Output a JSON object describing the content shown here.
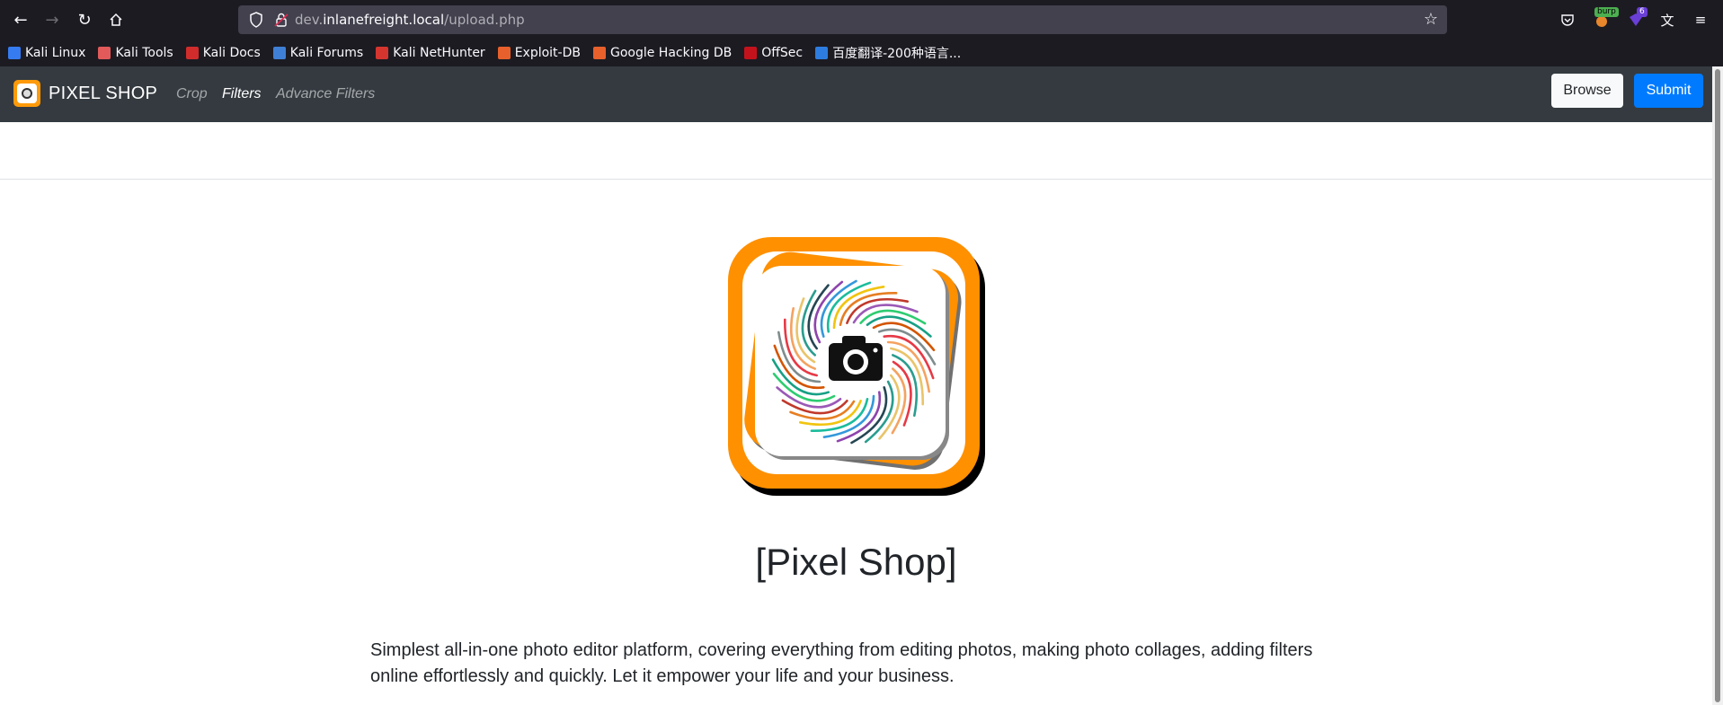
{
  "browser": {
    "url_prefix": "dev.",
    "url_host": "inlanefreight.local",
    "url_path": "/upload.php",
    "extensions": {
      "burp_badge": "burp",
      "notif_badge": "6"
    }
  },
  "bookmarks": [
    {
      "label": "Kali Linux",
      "color": "#367bf0"
    },
    {
      "label": "Kali Tools",
      "color": "#e25a5a"
    },
    {
      "label": "Kali Docs",
      "color": "#d12c2c"
    },
    {
      "label": "Kali Forums",
      "color": "#3f7fd6"
    },
    {
      "label": "Kali NetHunter",
      "color": "#d6352f"
    },
    {
      "label": "Exploit-DB",
      "color": "#e8602c"
    },
    {
      "label": "Google Hacking DB",
      "color": "#e8602c"
    },
    {
      "label": "OffSec",
      "color": "#c4121d"
    },
    {
      "label": "百度翻译-200种语言...",
      "color": "#2d7de0"
    }
  ],
  "navbar": {
    "brand": "PIXEL SHOP",
    "links": [
      {
        "label": "Crop",
        "active": false
      },
      {
        "label": "Filters",
        "active": true
      },
      {
        "label": "Advance Filters",
        "active": false
      }
    ],
    "browse_label": "Browse",
    "submit_label": "Submit",
    "bg_color": "#343a40",
    "primary_color": "#007bff"
  },
  "hero": {
    "title": "[Pixel Shop]",
    "description": "Simplest all-in-one photo editor platform, covering everything from editing photos, making photo collages, adding filters online effortlessly and quickly. Let it empower your life and your business.",
    "logo_color": "#ff9000"
  }
}
